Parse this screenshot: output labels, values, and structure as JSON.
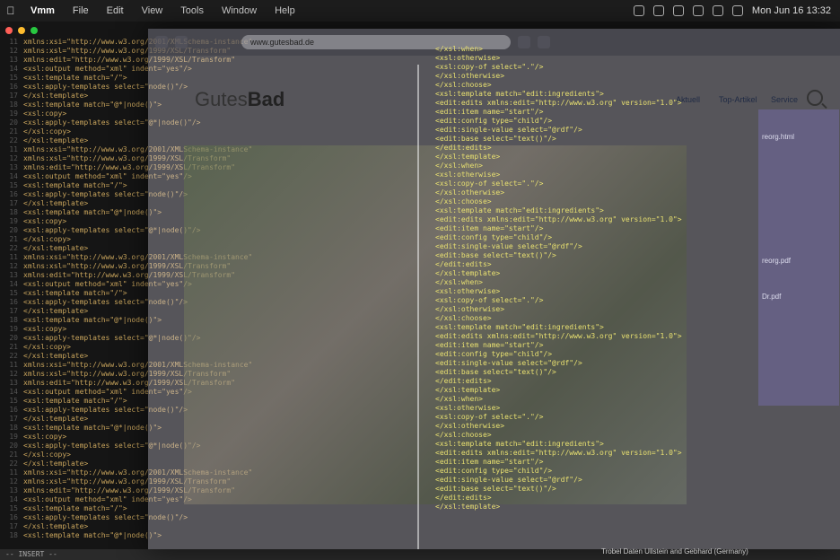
{
  "menubar": {
    "items": [
      "Vmm",
      "File",
      "Edit",
      "View",
      "Tools",
      "Window",
      "Help"
    ],
    "clock": "Mon Jun 16 13:32"
  },
  "window": {
    "traffic_lights": [
      "#ff5f57",
      "#febc2e",
      "#28c840"
    ]
  },
  "code_lines": [
    {
      "n": "11",
      "t": "  xmlns:xsi=\"http://www.w3.org/2001/XMLSchema-instance\""
    },
    {
      "n": "12",
      "t": "  xmlns:xsl=\"http://www.w3.org/1999/XSL/Transform\""
    },
    {
      "n": "13",
      "t": "  xmlns:edit=\"http://www.w3.org/1999/XSL/Transform\""
    },
    {
      "n": "14",
      "t": "  <xsl:output method=\"xml\" indent=\"yes\"/>"
    },
    {
      "n": "15",
      "t": "  <xsl:template match=\"/\">"
    },
    {
      "n": "16",
      "t": "    <xsl:apply-templates select=\"node()\"/>"
    },
    {
      "n": "17",
      "t": "  </xsl:template>"
    },
    {
      "n": "18",
      "t": "  <xsl:template match=\"@*|node()\">"
    },
    {
      "n": "19",
      "t": "    <xsl:copy>"
    },
    {
      "n": "20",
      "t": "      <xsl:apply-templates select=\"@*|node()\"/>"
    },
    {
      "n": "21",
      "t": "    </xsl:copy>"
    },
    {
      "n": "22",
      "t": "  </xsl:template>"
    }
  ],
  "browser": {
    "url": "www.gutesbad.de",
    "logo_prefix": "Gutes",
    "logo_bold": "Bad",
    "nav": [
      "Aktuell",
      "Top-Artikel",
      "Service"
    ]
  },
  "xml_lines": [
    "</xsl:when>",
    "<xsl:otherwise>",
    "  <xsl:copy-of select=\".\"/>",
    "</xsl:otherwise>",
    "</xsl:choose>",
    "<xsl:template match=\"edit:ingredients\">",
    "  <edit:edits xmlns:edit=\"http://www.w3.org\" version=\"1.0\">",
    "    <edit:item name=\"start\"/>",
    "    <edit:config type=\"child\"/>",
    "    <edit:single-value select=\"@rdf\"/>",
    "    <edit:base select=\"text()\"/>",
    "  </edit:edits>",
    "</xsl:template>"
  ],
  "side_files": [
    "reorg.html",
    "reorg.pdf",
    "Dr.pdf"
  ],
  "footer_caption": "Trobel Daten Ullstein and Gebhard (Germany)",
  "status_text": "-- INSERT --"
}
